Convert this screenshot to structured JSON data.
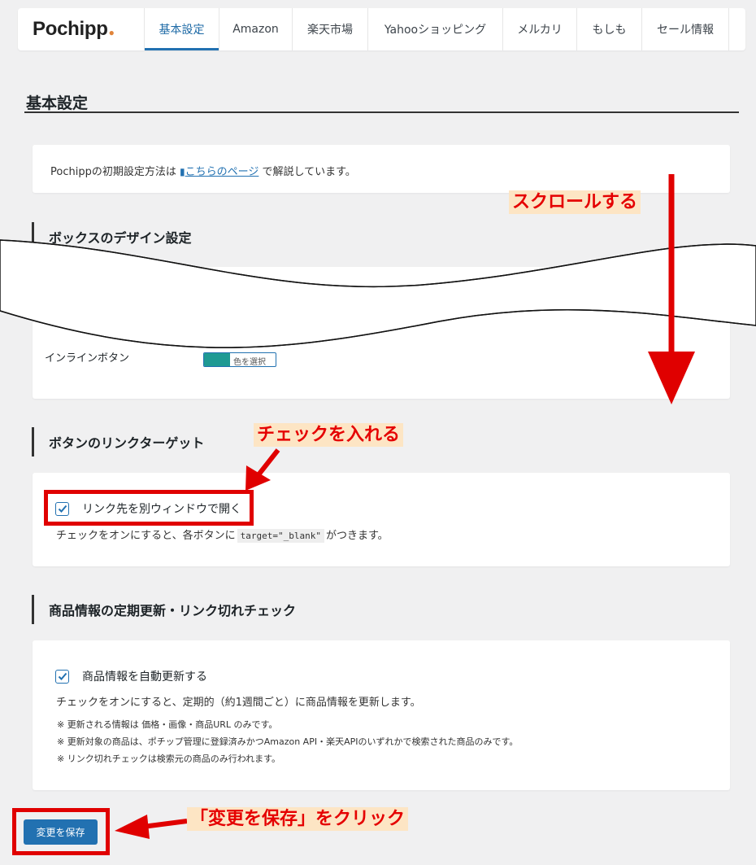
{
  "nav": {
    "logo": "Pochipp",
    "tabs": [
      "基本設定",
      "Amazon",
      "楽天市場",
      "Yahooショッピング",
      "メルカリ",
      "もしも",
      "セール情報"
    ]
  },
  "page_title": "基本設定",
  "info": {
    "prefix": "Pochippの初期設定方法は",
    "link": "こちらのページ",
    "suffix": "で解説しています。"
  },
  "box_design": {
    "title": "ボックスのデザイン設定",
    "inline_button_label": "インラインボタン",
    "toggle_label": "色を選択"
  },
  "link_target": {
    "title": "ボタンのリンクターゲット",
    "checkbox_label": "リンク先を別ウィンドウで開く",
    "checked": true,
    "desc_prefix": "チェックをオンにすると、各ボタンに",
    "desc_code": "target=\"_blank\"",
    "desc_suffix": "がつきます。"
  },
  "auto_update": {
    "title": "商品情報の定期更新・リンク切れチェック",
    "checkbox_label": "商品情報を自動更新する",
    "checked": true,
    "desc": "チェックをオンにすると、定期的（約1週間ごと）に商品情報を更新します。",
    "notes": [
      "※ 更新される情報は 価格・画像・商品URL のみです。",
      "※ 更新対象の商品は、ポチップ管理に登録済みかつAmazon API・楽天APIのいずれかで検索された商品のみです。",
      "※ リンク切れチェックは検索元の商品のみ行われます。"
    ]
  },
  "save_button": "変更を保存",
  "annotations": {
    "scroll": "スクロールする",
    "check": "チェックを入れる",
    "click_save": "「変更を保存」をクリック"
  },
  "colors": {
    "accent": "#2271b1",
    "annotation_red": "#e50000",
    "annotation_bg": "#fde5c4",
    "toggle_color": "#1f9a93"
  }
}
